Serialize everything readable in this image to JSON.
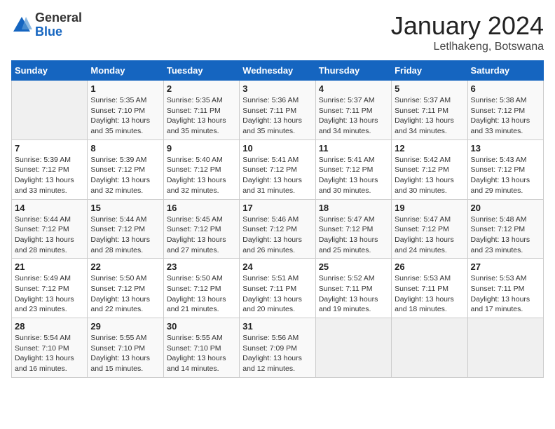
{
  "header": {
    "logo_general": "General",
    "logo_blue": "Blue",
    "month": "January 2024",
    "location": "Letlhakeng, Botswana"
  },
  "days_of_week": [
    "Sunday",
    "Monday",
    "Tuesday",
    "Wednesday",
    "Thursday",
    "Friday",
    "Saturday"
  ],
  "weeks": [
    [
      {
        "day": "",
        "sunrise": "",
        "sunset": "",
        "daylight": ""
      },
      {
        "day": "1",
        "sunrise": "Sunrise: 5:35 AM",
        "sunset": "Sunset: 7:10 PM",
        "daylight": "Daylight: 13 hours and 35 minutes."
      },
      {
        "day": "2",
        "sunrise": "Sunrise: 5:35 AM",
        "sunset": "Sunset: 7:11 PM",
        "daylight": "Daylight: 13 hours and 35 minutes."
      },
      {
        "day": "3",
        "sunrise": "Sunrise: 5:36 AM",
        "sunset": "Sunset: 7:11 PM",
        "daylight": "Daylight: 13 hours and 35 minutes."
      },
      {
        "day": "4",
        "sunrise": "Sunrise: 5:37 AM",
        "sunset": "Sunset: 7:11 PM",
        "daylight": "Daylight: 13 hours and 34 minutes."
      },
      {
        "day": "5",
        "sunrise": "Sunrise: 5:37 AM",
        "sunset": "Sunset: 7:11 PM",
        "daylight": "Daylight: 13 hours and 34 minutes."
      },
      {
        "day": "6",
        "sunrise": "Sunrise: 5:38 AM",
        "sunset": "Sunset: 7:12 PM",
        "daylight": "Daylight: 13 hours and 33 minutes."
      }
    ],
    [
      {
        "day": "7",
        "sunrise": "Sunrise: 5:39 AM",
        "sunset": "Sunset: 7:12 PM",
        "daylight": "Daylight: 13 hours and 33 minutes."
      },
      {
        "day": "8",
        "sunrise": "Sunrise: 5:39 AM",
        "sunset": "Sunset: 7:12 PM",
        "daylight": "Daylight: 13 hours and 32 minutes."
      },
      {
        "day": "9",
        "sunrise": "Sunrise: 5:40 AM",
        "sunset": "Sunset: 7:12 PM",
        "daylight": "Daylight: 13 hours and 32 minutes."
      },
      {
        "day": "10",
        "sunrise": "Sunrise: 5:41 AM",
        "sunset": "Sunset: 7:12 PM",
        "daylight": "Daylight: 13 hours and 31 minutes."
      },
      {
        "day": "11",
        "sunrise": "Sunrise: 5:41 AM",
        "sunset": "Sunset: 7:12 PM",
        "daylight": "Daylight: 13 hours and 30 minutes."
      },
      {
        "day": "12",
        "sunrise": "Sunrise: 5:42 AM",
        "sunset": "Sunset: 7:12 PM",
        "daylight": "Daylight: 13 hours and 30 minutes."
      },
      {
        "day": "13",
        "sunrise": "Sunrise: 5:43 AM",
        "sunset": "Sunset: 7:12 PM",
        "daylight": "Daylight: 13 hours and 29 minutes."
      }
    ],
    [
      {
        "day": "14",
        "sunrise": "Sunrise: 5:44 AM",
        "sunset": "Sunset: 7:12 PM",
        "daylight": "Daylight: 13 hours and 28 minutes."
      },
      {
        "day": "15",
        "sunrise": "Sunrise: 5:44 AM",
        "sunset": "Sunset: 7:12 PM",
        "daylight": "Daylight: 13 hours and 28 minutes."
      },
      {
        "day": "16",
        "sunrise": "Sunrise: 5:45 AM",
        "sunset": "Sunset: 7:12 PM",
        "daylight": "Daylight: 13 hours and 27 minutes."
      },
      {
        "day": "17",
        "sunrise": "Sunrise: 5:46 AM",
        "sunset": "Sunset: 7:12 PM",
        "daylight": "Daylight: 13 hours and 26 minutes."
      },
      {
        "day": "18",
        "sunrise": "Sunrise: 5:47 AM",
        "sunset": "Sunset: 7:12 PM",
        "daylight": "Daylight: 13 hours and 25 minutes."
      },
      {
        "day": "19",
        "sunrise": "Sunrise: 5:47 AM",
        "sunset": "Sunset: 7:12 PM",
        "daylight": "Daylight: 13 hours and 24 minutes."
      },
      {
        "day": "20",
        "sunrise": "Sunrise: 5:48 AM",
        "sunset": "Sunset: 7:12 PM",
        "daylight": "Daylight: 13 hours and 23 minutes."
      }
    ],
    [
      {
        "day": "21",
        "sunrise": "Sunrise: 5:49 AM",
        "sunset": "Sunset: 7:12 PM",
        "daylight": "Daylight: 13 hours and 23 minutes."
      },
      {
        "day": "22",
        "sunrise": "Sunrise: 5:50 AM",
        "sunset": "Sunset: 7:12 PM",
        "daylight": "Daylight: 13 hours and 22 minutes."
      },
      {
        "day": "23",
        "sunrise": "Sunrise: 5:50 AM",
        "sunset": "Sunset: 7:12 PM",
        "daylight": "Daylight: 13 hours and 21 minutes."
      },
      {
        "day": "24",
        "sunrise": "Sunrise: 5:51 AM",
        "sunset": "Sunset: 7:11 PM",
        "daylight": "Daylight: 13 hours and 20 minutes."
      },
      {
        "day": "25",
        "sunrise": "Sunrise: 5:52 AM",
        "sunset": "Sunset: 7:11 PM",
        "daylight": "Daylight: 13 hours and 19 minutes."
      },
      {
        "day": "26",
        "sunrise": "Sunrise: 5:53 AM",
        "sunset": "Sunset: 7:11 PM",
        "daylight": "Daylight: 13 hours and 18 minutes."
      },
      {
        "day": "27",
        "sunrise": "Sunrise: 5:53 AM",
        "sunset": "Sunset: 7:11 PM",
        "daylight": "Daylight: 13 hours and 17 minutes."
      }
    ],
    [
      {
        "day": "28",
        "sunrise": "Sunrise: 5:54 AM",
        "sunset": "Sunset: 7:10 PM",
        "daylight": "Daylight: 13 hours and 16 minutes."
      },
      {
        "day": "29",
        "sunrise": "Sunrise: 5:55 AM",
        "sunset": "Sunset: 7:10 PM",
        "daylight": "Daylight: 13 hours and 15 minutes."
      },
      {
        "day": "30",
        "sunrise": "Sunrise: 5:55 AM",
        "sunset": "Sunset: 7:10 PM",
        "daylight": "Daylight: 13 hours and 14 minutes."
      },
      {
        "day": "31",
        "sunrise": "Sunrise: 5:56 AM",
        "sunset": "Sunset: 7:09 PM",
        "daylight": "Daylight: 13 hours and 12 minutes."
      },
      {
        "day": "",
        "sunrise": "",
        "sunset": "",
        "daylight": ""
      },
      {
        "day": "",
        "sunrise": "",
        "sunset": "",
        "daylight": ""
      },
      {
        "day": "",
        "sunrise": "",
        "sunset": "",
        "daylight": ""
      }
    ]
  ]
}
